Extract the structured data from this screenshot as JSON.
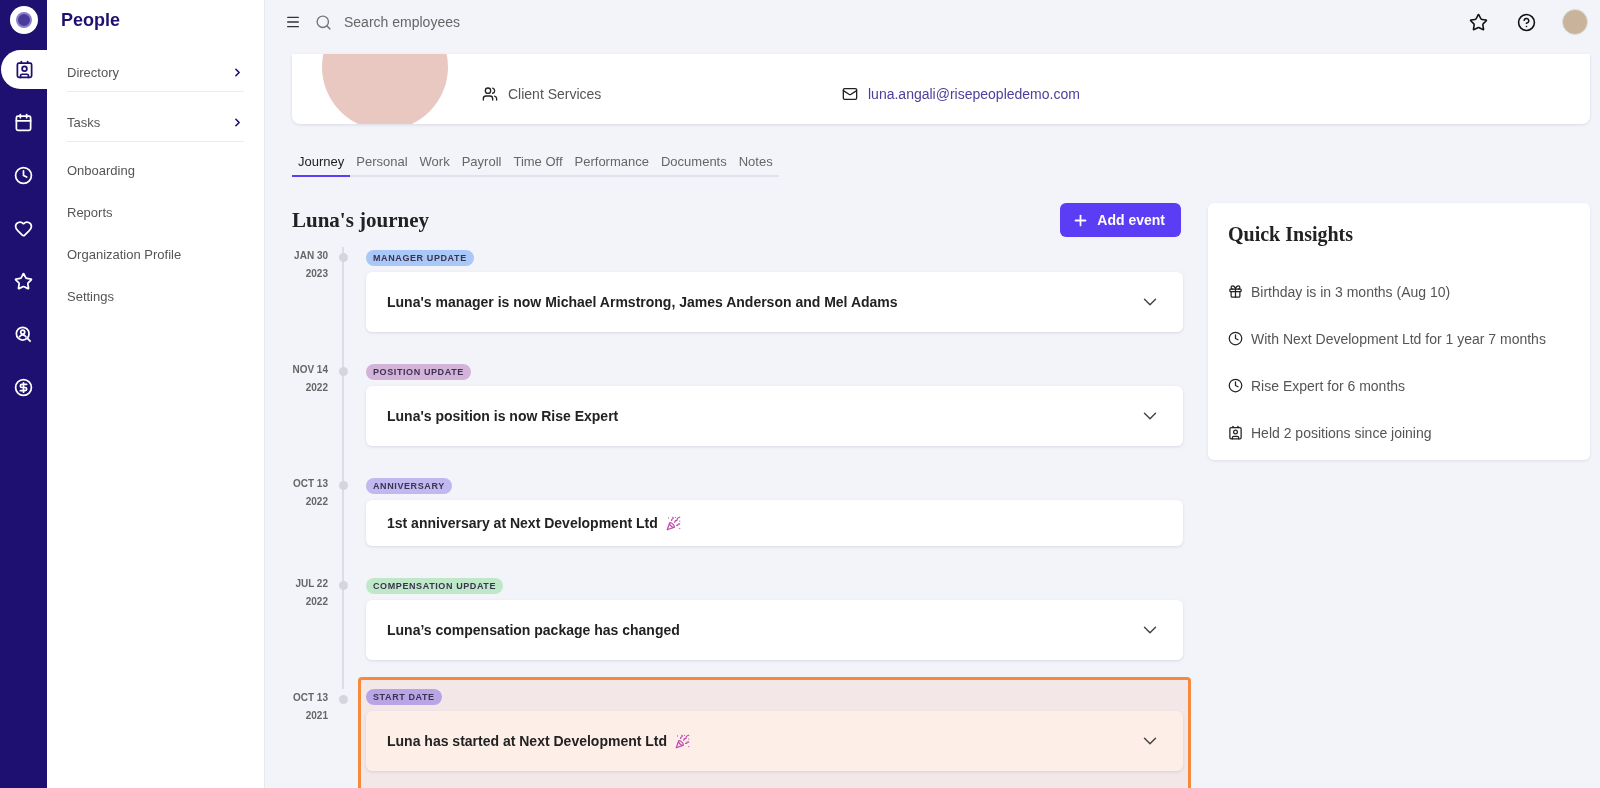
{
  "rail": [
    {
      "kind": "people",
      "selected": true
    },
    {
      "kind": "calendar",
      "selected": false
    },
    {
      "kind": "clock",
      "selected": false
    },
    {
      "kind": "heart",
      "selected": false
    },
    {
      "kind": "star",
      "selected": false
    },
    {
      "kind": "search",
      "selected": false
    },
    {
      "kind": "dollar",
      "selected": false
    }
  ],
  "sidebar": {
    "title": "People",
    "items": [
      {
        "label": "Directory",
        "submenu": true
      },
      {
        "label": "Tasks",
        "submenu": true
      },
      {
        "label": "Onboarding",
        "submenu": false
      },
      {
        "label": "Reports",
        "submenu": false
      },
      {
        "label": "Organization Profile",
        "submenu": false
      },
      {
        "label": "Settings",
        "submenu": false
      }
    ]
  },
  "topbar": {
    "search": {
      "placeholder": "Search employees"
    }
  },
  "profile": {
    "department": "Client Services",
    "email": "luna.angali@risepeopledemo.com"
  },
  "tabs": [
    {
      "label": "Journey",
      "selected": true
    },
    {
      "label": "Personal",
      "selected": false
    },
    {
      "label": "Work",
      "selected": false
    },
    {
      "label": "Payroll",
      "selected": false
    },
    {
      "label": "Time Off",
      "selected": false
    },
    {
      "label": "Performance",
      "selected": false
    },
    {
      "label": "Documents",
      "selected": false
    },
    {
      "label": "Notes",
      "selected": false
    }
  ],
  "journey": {
    "title": "Luna's journey",
    "add_button": "Add event",
    "events": [
      {
        "date": "JAN 30",
        "year": "2023",
        "tag": "MANAGER UPDATE",
        "color": "#a9c8f7",
        "text": "Luna's manager is now Michael Armstrong, James Anderson and Mel Adams",
        "expandable": true,
        "celebration": false,
        "highlighted": false
      },
      {
        "date": "NOV 14",
        "year": "2022",
        "tag": "POSITION UPDATE",
        "color": "#d4b3d9",
        "text": "Luna's position is now Rise Expert",
        "expandable": true,
        "celebration": false,
        "highlighted": false
      },
      {
        "date": "OCT 13",
        "year": "2022",
        "tag": "ANNIVERSARY",
        "color": "#c2b8f0",
        "text": "1st anniversary at Next Development Ltd",
        "expandable": false,
        "celebration": true,
        "highlighted": false
      },
      {
        "date": "JUL 22",
        "year": "2022",
        "tag": "COMPENSATION UPDATE",
        "color": "#bfe8c8",
        "text": "Luna’s compensation package has changed",
        "expandable": true,
        "celebration": false,
        "highlighted": false
      },
      {
        "date": "OCT 13",
        "year": "2021",
        "tag": "START DATE",
        "color": "#b9a5e6",
        "text": "Luna has started at Next Development Ltd",
        "expandable": true,
        "celebration": true,
        "highlighted": true
      }
    ]
  },
  "insights": {
    "title": "Quick Insights",
    "items": [
      {
        "kind": "gift",
        "text": "Birthday is in 3 months (Aug 10)"
      },
      {
        "kind": "clock",
        "text": "With Next Development Ltd for 1 year 7 months"
      },
      {
        "kind": "clock",
        "text": "Rise Expert for 6 months"
      },
      {
        "kind": "card",
        "text": "Held 2 positions since joining"
      }
    ]
  }
}
